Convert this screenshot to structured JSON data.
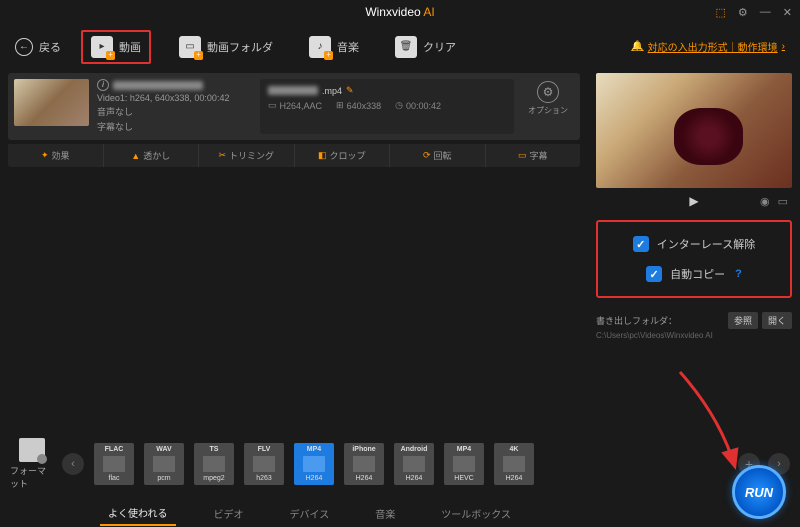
{
  "title": {
    "brand": "Winxvideo",
    "suffix": "AI"
  },
  "toolbar": {
    "back": "戻る",
    "items": [
      {
        "label": "動画",
        "active": true
      },
      {
        "label": "動画フォルダ"
      },
      {
        "label": "音楽"
      },
      {
        "label": "クリア"
      }
    ],
    "io_link": "対応の入出力形式｜動作環境"
  },
  "item": {
    "video_info": "Video1: h264, 640x338, 00:00:42",
    "audio_info": "音声なし",
    "subtitle_info": "字幕なし",
    "output_name": ".mp4",
    "codec": "H264,AAC",
    "resolution": "640x338",
    "duration": "00:00:42",
    "option_label": "オプション"
  },
  "tabs": [
    {
      "icon": "✦",
      "label": "効果"
    },
    {
      "icon": "▲",
      "label": "透かし"
    },
    {
      "icon": "✂",
      "label": "トリミング"
    },
    {
      "icon": "◧",
      "label": "クロップ"
    },
    {
      "icon": "⟳",
      "label": "回転"
    },
    {
      "icon": "▭",
      "label": "字幕"
    }
  ],
  "options": {
    "deinterlace": "インターレース解除",
    "autocopy": "自動コピー"
  },
  "output": {
    "label": "書き出しフォルダ：",
    "browse": "参照",
    "open": "開く",
    "path": "C:\\Users\\pc\\Videos\\Winxvideo AI"
  },
  "format_label": "フォーマット",
  "formats": [
    {
      "top": "FLAC",
      "bot": "flac"
    },
    {
      "top": "WAV",
      "bot": "pcm"
    },
    {
      "top": "TS",
      "bot": "mpeg2"
    },
    {
      "top": "FLV",
      "bot": "h263"
    },
    {
      "top": "MP4",
      "bot": "H264",
      "active": true
    },
    {
      "top": "iPhone",
      "bot": "H264"
    },
    {
      "top": "Android",
      "bot": "H264"
    },
    {
      "top": "MP4",
      "bot": "HEVC"
    },
    {
      "top": "4K",
      "bot": "H264"
    }
  ],
  "bottom_tabs": [
    {
      "label": "よく使われる",
      "active": true
    },
    {
      "label": "ビデオ"
    },
    {
      "label": "デバイス"
    },
    {
      "label": "音楽"
    },
    {
      "label": "ツールボックス"
    }
  ],
  "run": "RUN"
}
